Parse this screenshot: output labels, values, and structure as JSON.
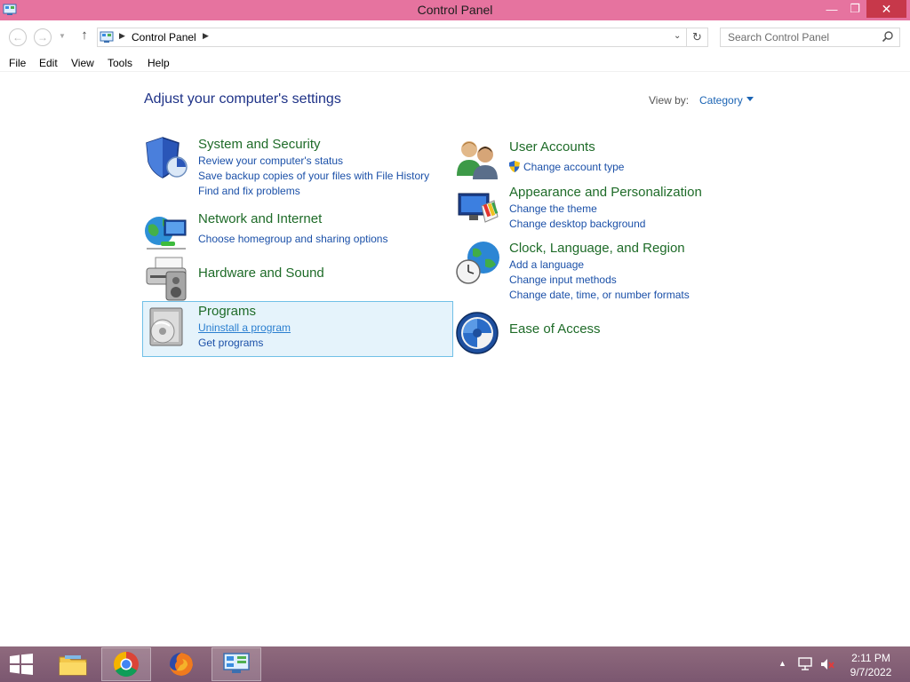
{
  "window": {
    "title": "Control Panel",
    "minimize_label": "—",
    "maximize_label": "❐",
    "close_label": "✕"
  },
  "address": {
    "breadcrumb": "Control Panel",
    "search_placeholder": "Search Control Panel"
  },
  "menu": [
    "File",
    "Edit",
    "View",
    "Tools",
    "Help"
  ],
  "content": {
    "heading": "Adjust your computer's settings",
    "view_by_label": "View by:",
    "view_by_value": "Category"
  },
  "categories": [
    {
      "title": "System and Security",
      "icon": "shield-icon",
      "links": [
        "Review your computer's status",
        "Save backup copies of your files with File History",
        "Find and fix problems"
      ]
    },
    {
      "title": "Network and Internet",
      "icon": "network-globe-icon",
      "links": [
        "Choose homegroup and sharing options"
      ]
    },
    {
      "title": "Hardware and Sound",
      "icon": "printer-speaker-icon",
      "links": []
    },
    {
      "title": "Programs",
      "icon": "programs-disc-icon",
      "links": [
        "Uninstall a program",
        "Get programs"
      ]
    },
    {
      "title": "User Accounts",
      "icon": "users-icon",
      "links": [
        "Change account type"
      ]
    },
    {
      "title": "Appearance and Personalization",
      "icon": "monitor-palette-icon",
      "links": [
        "Change the theme",
        "Change desktop background"
      ]
    },
    {
      "title": "Clock, Language, and Region",
      "icon": "clock-globe-icon",
      "links": [
        "Add a language",
        "Change input methods",
        "Change date, time, or number formats"
      ]
    },
    {
      "title": "Ease of Access",
      "icon": "ease-of-access-icon",
      "links": []
    }
  ],
  "taskbar": {
    "time": "2:11 PM",
    "date": "9/7/2022"
  },
  "colors": {
    "titlebar": "#e6739f",
    "category_title": "#1e6b28",
    "link": "#1b50a8",
    "heading": "#1e3287",
    "taskbar": "#7b5770"
  }
}
